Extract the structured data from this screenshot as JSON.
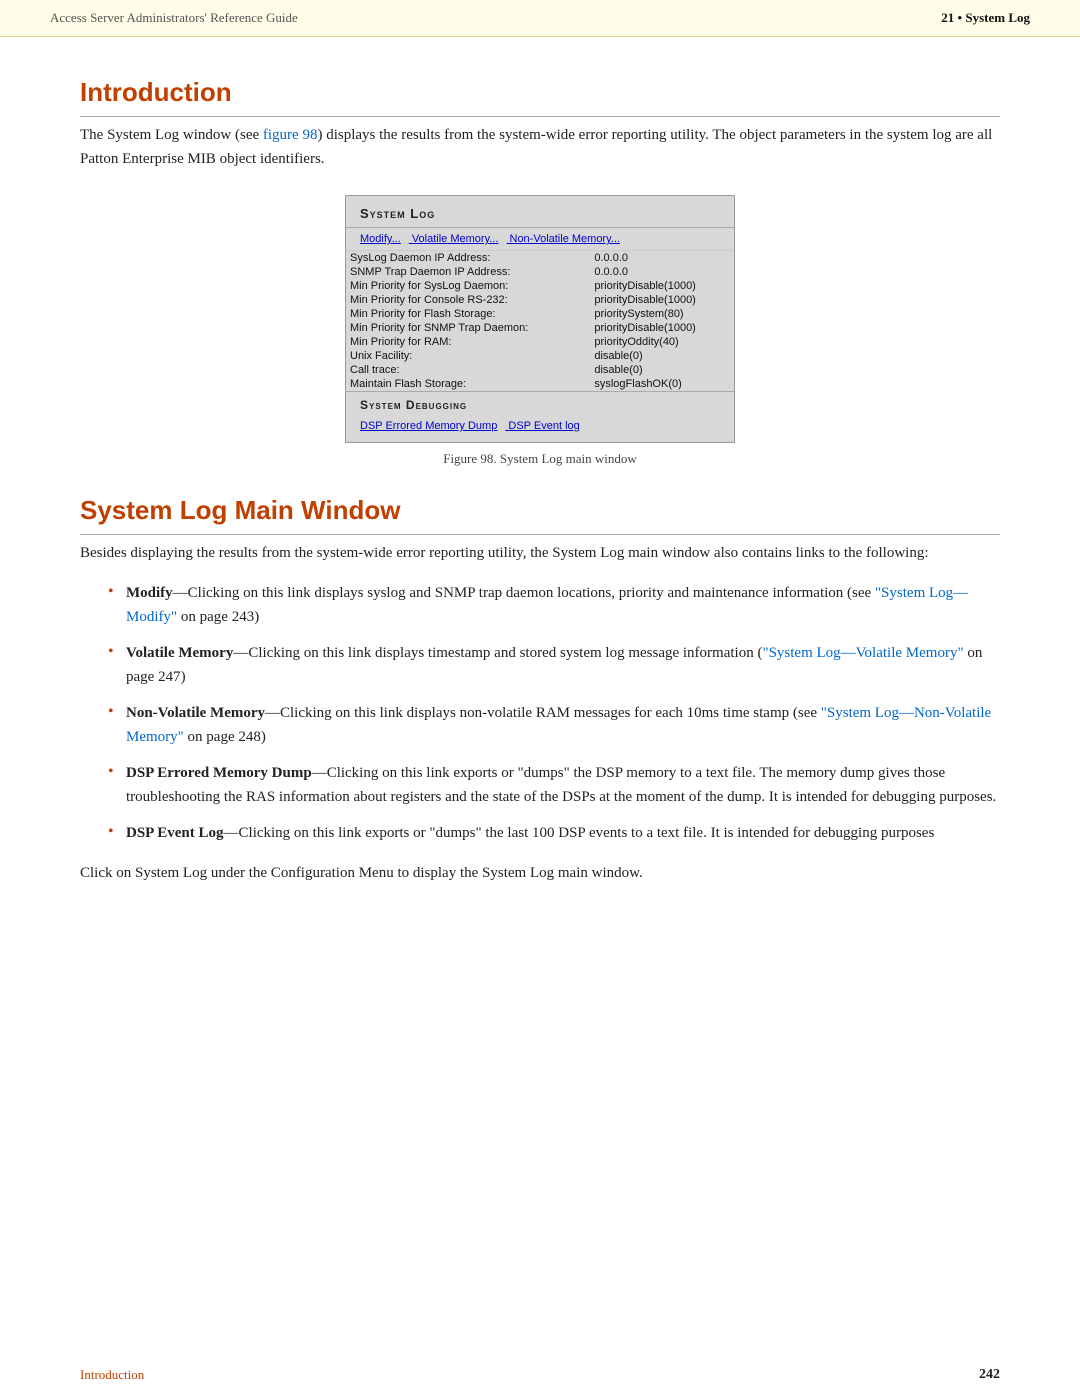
{
  "header": {
    "left": "Access Server Administrators' Reference Guide",
    "right": "21 • System Log"
  },
  "intro_section": {
    "title": "Introduction",
    "body1": "The System Log window (see figure 98) displays the results from the system-wide error reporting utility. The object parameters in the system log are all Patton Enterprise MIB object identifiers."
  },
  "figure": {
    "title": "SYSTEM LOG",
    "links_row": "Modify...   Volatile Memory...   Non-Volatile Memory...",
    "rows": [
      {
        "label": "SysLog Daemon IP Address:",
        "value": "0.0.0.0"
      },
      {
        "label": "SNMP Trap Daemon IP Address:",
        "value": "0.0.0.0"
      },
      {
        "label": "Min Priority for SysLog Daemon:",
        "value": "priorityDisable(1000)"
      },
      {
        "label": "Min Priority for Console RS-232:",
        "value": "priorityDisable(1000)"
      },
      {
        "label": "Min Priority for Flash Storage:",
        "value": "prioritySystem(80)"
      },
      {
        "label": "Min Priority for SNMP Trap Daemon:",
        "value": "priorityDisable(1000)"
      },
      {
        "label": "Min Priority for RAM:",
        "value": "priorityOddity(40)"
      },
      {
        "label": "Unix Facility:",
        "value": "disable(0)"
      },
      {
        "label": "Call trace:",
        "value": "disable(0)"
      },
      {
        "label": "Maintain Flash Storage:",
        "value": "syslogFlashOK(0)"
      }
    ],
    "debug_title": "SYSTEM DEBUGGING",
    "debug_links": "DSP Errored Memory Dump   DSP Event log",
    "caption": "Figure 98. System Log main window"
  },
  "syslog_section": {
    "title": "System Log Main Window",
    "body1": "Besides displaying the results from the system-wide error reporting utility, the System Log main window also contains links to the following:",
    "bullets": [
      {
        "bold": "Modify",
        "text": "—Clicking on this link displays syslog and SNMP trap daemon locations, priority and maintenance information (see ",
        "link_text": "\"System Log—Modify\"",
        "link_suffix": " on page 243)"
      },
      {
        "bold": "Volatile Memory",
        "text": "—Clicking on this link displays timestamp and stored system log message information (",
        "link_text": "\"System Log—Volatile Memory\"",
        "link_suffix": " on page 247)"
      },
      {
        "bold": "Non-Volatile Memory",
        "text": "—Clicking on this link displays non-volatile RAM messages for each 10ms time stamp (see ",
        "link_text": "\"System Log—Non-Volatile Memory\"",
        "link_suffix": " on page 248)"
      },
      {
        "bold": "DSP Errored Memory Dump",
        "text": "—Clicking on this link exports or \"dumps\" the DSP memory to a text file. The memory dump gives those troubleshooting the RAS information about registers and the state of the DSPs at the moment of the dump. It is intended for debugging purposes.",
        "link_text": "",
        "link_suffix": ""
      },
      {
        "bold": "DSP Event Log",
        "text": "—Clicking on this link exports or \"dumps\" the last 100 DSP events to a text file. It is intended for debugging purposes",
        "link_text": "",
        "link_suffix": ""
      }
    ],
    "body2": "Click on System Log under the Configuration Menu to display the System Log main window."
  },
  "footer": {
    "left": "Introduction",
    "right": "242"
  }
}
